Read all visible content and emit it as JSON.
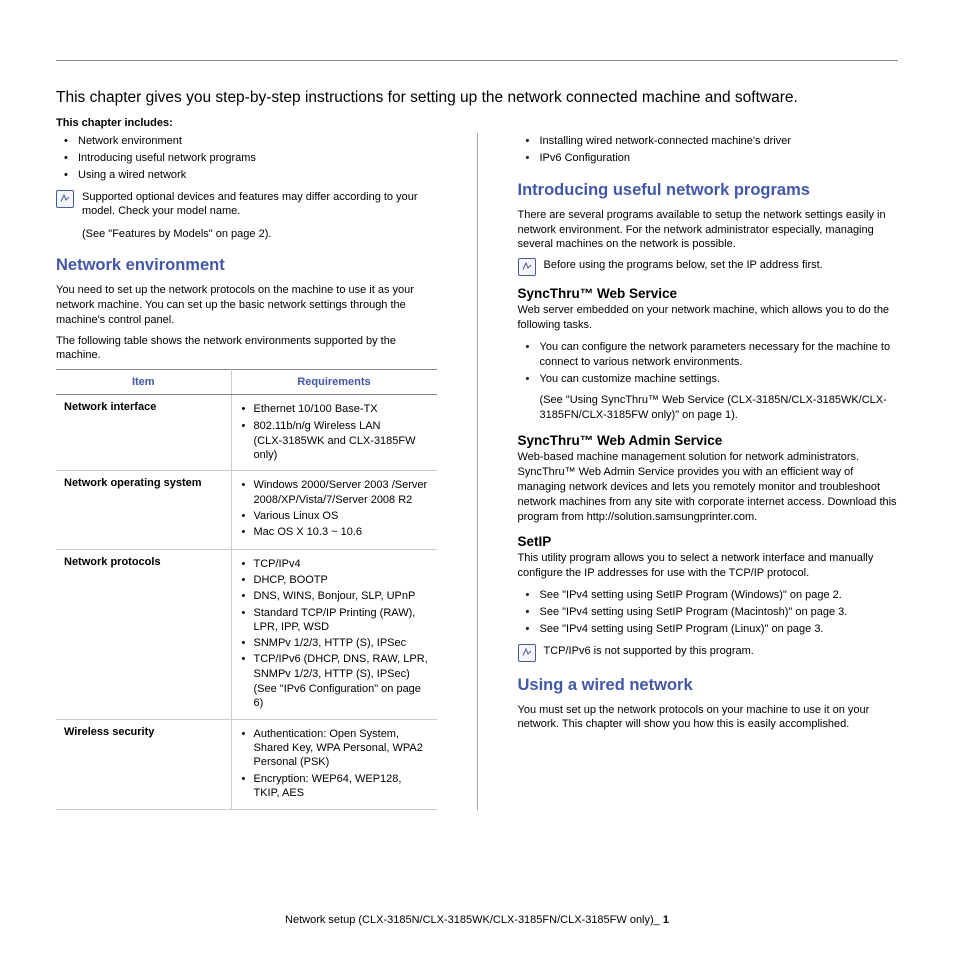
{
  "intro": "This chapter gives you step-by-step instructions for setting up the network connected machine and software.",
  "includes_label": "This chapter includes:",
  "left_bullets": [
    "Network environment",
    "Introducing useful network programs",
    "Using a wired network"
  ],
  "right_bullets": [
    "Installing wired network-connected machine's driver",
    "IPv6 Configuration"
  ],
  "note1": "Supported optional devices and features may differ according to your model. Check your model name.",
  "note1_sub": "(See \"Features by Models\" on page 2).",
  "sec_env": {
    "title": "Network environment",
    "p1": "You need to set up the network protocols on the machine to use it as your network machine. You can set up the basic network settings through the machine's control panel.",
    "p2": "The following table shows the network environments supported by the machine."
  },
  "table": {
    "col1": "Item",
    "col2": "Requirements",
    "rows": [
      {
        "label": "Network interface",
        "items": [
          "Ethernet 10/100 Base-TX",
          "802.11b/n/g Wireless LAN"
        ],
        "sub": "(CLX-3185WK and CLX-3185FW only)"
      },
      {
        "label": "Network operating system",
        "items": [
          "Windows 2000/Server 2003 /Server 2008/XP/Vista/7/Server 2008 R2",
          "Various Linux OS",
          "Mac OS X 10.3 ~ 10.6"
        ]
      },
      {
        "label": "Network protocols",
        "items": [
          "TCP/IPv4",
          "DHCP, BOOTP",
          "DNS, WINS, Bonjour, SLP, UPnP",
          "Standard TCP/IP Printing (RAW), LPR, IPP, WSD",
          "SNMPv 1/2/3, HTTP (S), IPSec",
          "TCP/IPv6 (DHCP, DNS, RAW, LPR, SNMPv 1/2/3, HTTP (S), IPSec)"
        ],
        "sub": "(See \"IPv6 Configuration\" on page 6)"
      },
      {
        "label": "Wireless security",
        "items": [
          "Authentication: Open System, Shared Key, WPA Personal, WPA2 Personal (PSK)",
          "Encryption: WEP64, WEP128, TKIP, AES"
        ]
      }
    ]
  },
  "sec_programs": {
    "title": "Introducing useful network programs",
    "intro": "There are several programs available to setup the network settings easily in network environment. For the network administrator especially, managing several machines on the network is possible.",
    "note": "Before using the programs below, set the IP address first.",
    "sync_web": {
      "title": "SyncThru™ Web Service",
      "desc": "Web server embedded on your network machine, which allows you to do the following tasks.",
      "b1": "You can configure the network parameters necessary for the machine to connect to various network environments.",
      "b2": "You can customize machine settings.",
      "b2_sub": "(See \"Using SyncThru™ Web Service (CLX-3185N/CLX-3185WK/CLX-3185FN/CLX-3185FW only)\" on page 1)."
    },
    "sync_admin": {
      "title": "SyncThru™ Web Admin Service",
      "desc": "Web-based machine management solution for network administrators. SyncThru™ Web Admin Service provides you with an efficient way of managing network devices and lets you remotely monitor and troubleshoot network machines from any site with corporate internet access. Download this program from http://solution.samsungprinter.com."
    },
    "setip": {
      "title": "SetIP",
      "desc": "This utility program allows you to select a network interface and manually configure the IP addresses for use with the TCP/IP protocol.",
      "b1": "See \"IPv4 setting using SetIP Program (Windows)\" on page 2.",
      "b2": "See \"IPv4 setting using SetIP Program (Macintosh)\" on page 3.",
      "b3": "See \"IPv4 setting using SetIP Program (Linux)\" on page 3.",
      "note": "TCP/IPv6 is not supported by this program."
    }
  },
  "sec_wired": {
    "title": "Using a wired network",
    "desc": "You must set up the network protocols on your machine to use it on your network. This chapter will show you how this is easily accomplished."
  },
  "footer": {
    "text": "Network setup (CLX-3185N/CLX-3185WK/CLX-3185FN/CLX-3185FW only)_",
    "page": "1"
  }
}
